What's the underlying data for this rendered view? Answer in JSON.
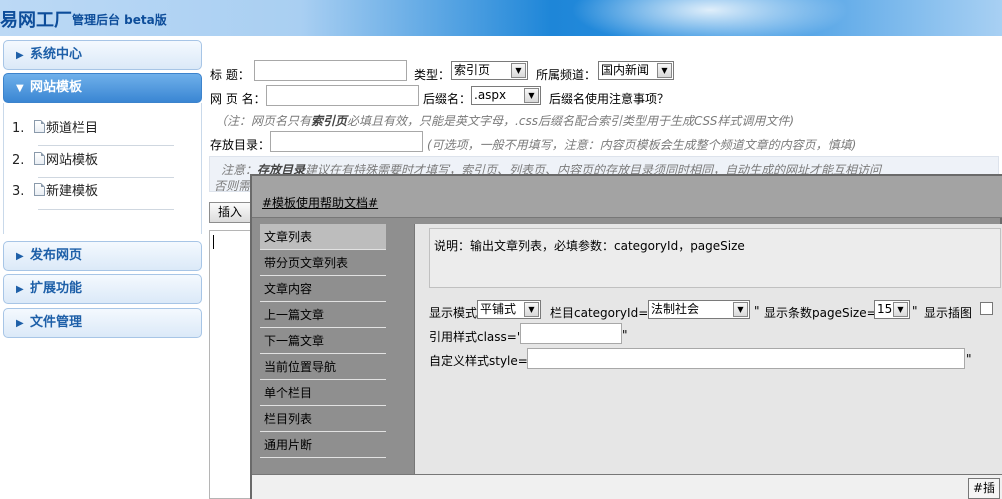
{
  "header": {
    "logo": "易网工厂",
    "subtitle": "管理后台 beta版"
  },
  "sidebar": {
    "sections": [
      {
        "label": "系统中心"
      },
      {
        "label": "网站模板"
      },
      {
        "label": "发布网页"
      },
      {
        "label": "扩展功能"
      },
      {
        "label": "文件管理"
      }
    ],
    "sub_items": [
      {
        "num": "1.",
        "label": "频道栏目"
      },
      {
        "num": "2.",
        "label": "网站模板"
      },
      {
        "num": "3.",
        "label": "新建模板"
      }
    ]
  },
  "form": {
    "title_label": "标  题：",
    "type_label": "类型：",
    "type_value": "索引页",
    "channel_label": "所属频道：",
    "channel_value": "国内新闻",
    "pagename_label": "网 页 名：",
    "suffix_label": "后缀名：",
    "suffix_value": ".aspx",
    "suffix_hint": "后缀名使用注意事项？",
    "note1_a": "（注：网页名只有",
    "note1_b": "索引页",
    "note1_c": "必填且有效，只能是英文字母，.css后缀名配合索引类型用于生成CSS样式调用文件)",
    "dir_label": "存放目录：",
    "dir_hint": "(可选项，一般不用填写，注意：内容页模板会生成整个频道文章的内容页，慎填)",
    "note2_a": "注意：",
    "note2_b": "存放目录",
    "note2_c": "建议在有特殊需要时才填写，索引页、列表页、内容页的存放目录须同时相同，自动生成的网址才能互相访问",
    "note2_d": "否则需",
    "insert_button": "插入"
  },
  "dialog": {
    "title": "#模板使用帮助文档#",
    "menu": [
      "文章列表",
      "带分页文章列表",
      "文章内容",
      "上一篇文章",
      "下一篇文章",
      "当前位置导航",
      "单个栏目",
      "栏目列表",
      "通用片断"
    ],
    "active_menu_index": 0,
    "description": "说明：输出文章列表，必填参数：categoryId，pageSize",
    "display_mode_label": "显示模式",
    "display_mode_value": "平铺式",
    "category_label": "栏目categoryId=\"",
    "category_value": "法制社会",
    "quote_close": "\"",
    "pagesize_label": "显示条数pageSize=\"",
    "pagesize_value": "15",
    "show_image_label": "显示插图",
    "class_label": "引用样式class=\"",
    "style_label": "自定义样式style=\"",
    "footer_button": "#插"
  }
}
